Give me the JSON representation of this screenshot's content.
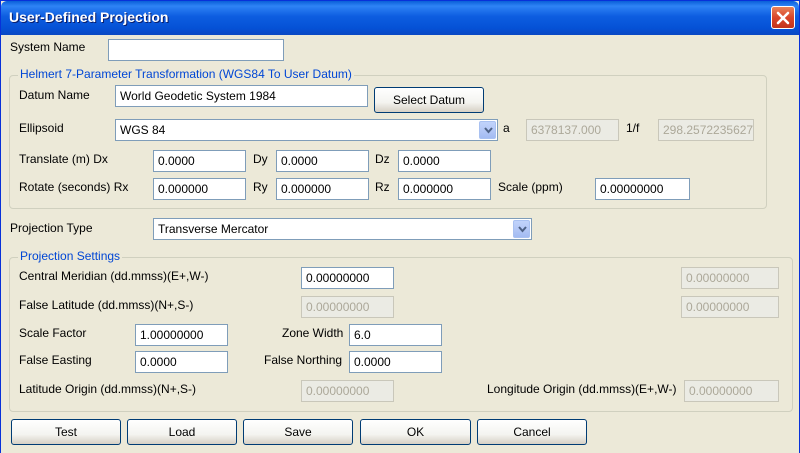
{
  "window": {
    "title": "User-Defined Projection"
  },
  "system_name": {
    "label": "System Name",
    "value": ""
  },
  "helmert": {
    "legend": "Helmert 7-Parameter Transformation (WGS84 To User Datum)",
    "datum_name_label": "Datum Name",
    "datum_name_value": "World Geodetic System 1984",
    "select_datum_label": "Select Datum",
    "ellipsoid_label": "Ellipsoid",
    "ellipsoid_value": "WGS 84",
    "a_label": "a",
    "a_value": "6378137.000",
    "f_label": "1/f",
    "f_value": "298.2572235627",
    "translate_label": "Translate (m) Dx",
    "dx_value": "0.0000",
    "dy_label": "Dy",
    "dy_value": "0.0000",
    "dz_label": "Dz",
    "dz_value": "0.0000",
    "rotate_label": "Rotate (seconds) Rx",
    "rx_value": "0.000000",
    "ry_label": "Ry",
    "ry_value": "0.000000",
    "rz_label": "Rz",
    "rz_value": "0.000000",
    "scale_label": "Scale (ppm)",
    "scale_value": "0.00000000"
  },
  "projection_type": {
    "label": "Projection Type",
    "value": "Transverse Mercator"
  },
  "projection_settings": {
    "legend": "Projection Settings",
    "central_meridian_label": "Central Meridian (dd.mmss)(E+,W-)",
    "central_meridian_value": "0.00000000",
    "central_meridian_alt_value": "0.00000000",
    "false_latitude_label": "False Latitude (dd.mmss)(N+,S-)",
    "false_latitude_value": "0.00000000",
    "false_latitude_alt_value": "0.00000000",
    "scale_factor_label": "Scale Factor",
    "scale_factor_value": "1.00000000",
    "zone_width_label": "Zone Width",
    "zone_width_value": "6.0",
    "false_easting_label": "False Easting",
    "false_easting_value": "0.0000",
    "false_northing_label": "False Northing",
    "false_northing_value": "0.0000",
    "latitude_origin_label": "Latitude Origin (dd.mmss)(N+,S-)",
    "latitude_origin_value": "0.00000000",
    "longitude_origin_label": "Longitude Origin (dd.mmss)(E+,W-)",
    "longitude_origin_value": "0.00000000"
  },
  "buttons": {
    "test": "Test",
    "load": "Load",
    "save": "Save",
    "ok": "OK",
    "cancel": "Cancel"
  },
  "colors": {
    "title_bar": "#0551d6",
    "group_legend": "#0046d5",
    "close_button": "#d9452a",
    "dialog_background": "#ece9d8"
  }
}
